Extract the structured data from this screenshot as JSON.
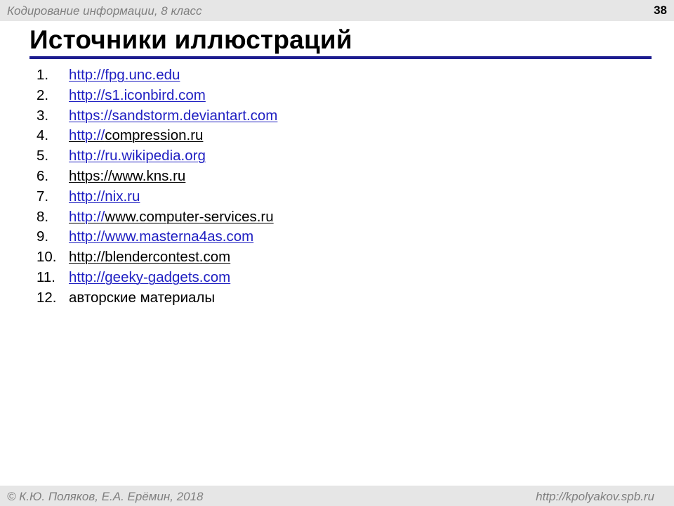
{
  "header": {
    "course_name": "Кодирование информации, 8 класс",
    "page_number": "38"
  },
  "slide": {
    "title": "Источники иллюстраций",
    "sources": [
      {
        "number": "1.",
        "text": "http://fpg.unc.edu",
        "style": "link-blue"
      },
      {
        "number": "2.",
        "text": "http://s1.iconbird.com",
        "style": "link-blue"
      },
      {
        "number": "3.",
        "text": "https://sandstorm.deviantart.com",
        "style": "link-blue"
      },
      {
        "number": "4.",
        "text_link": "http://",
        "text_rest": "compression.ru",
        "style": "mixed"
      },
      {
        "number": "5.",
        "text": "http://ru.wikipedia.org",
        "style": "link-blue"
      },
      {
        "number": "6.",
        "text": "https://www.kns.ru",
        "style": "link-black"
      },
      {
        "number": "7.",
        "text": "http://nix.ru",
        "style": "link-blue"
      },
      {
        "number": "8.",
        "text_link": "http://",
        "text_rest": "www.computer-services.ru",
        "style": "mixed"
      },
      {
        "number": "9.",
        "text": "http://www.masterna4as.com",
        "style": "link-blue"
      },
      {
        "number": "10.",
        "text": "http://blendercontest.com",
        "style": "link-black"
      },
      {
        "number": "11.",
        "text": "http://geeky-gadgets.com",
        "style": "link-blue"
      },
      {
        "number": "12.",
        "text": "авторские материалы",
        "style": "plain"
      }
    ]
  },
  "footer": {
    "copyright": "© К.Ю. Поляков, Е.А. Ерёмин, 2018",
    "site_url": "http://kpolyakov.spb.ru"
  },
  "colors": {
    "bar_background": "#e6e6e6",
    "title_rule": "#1c1c8f",
    "link": "#1f1fc2",
    "muted_text": "#7f7f7f"
  }
}
